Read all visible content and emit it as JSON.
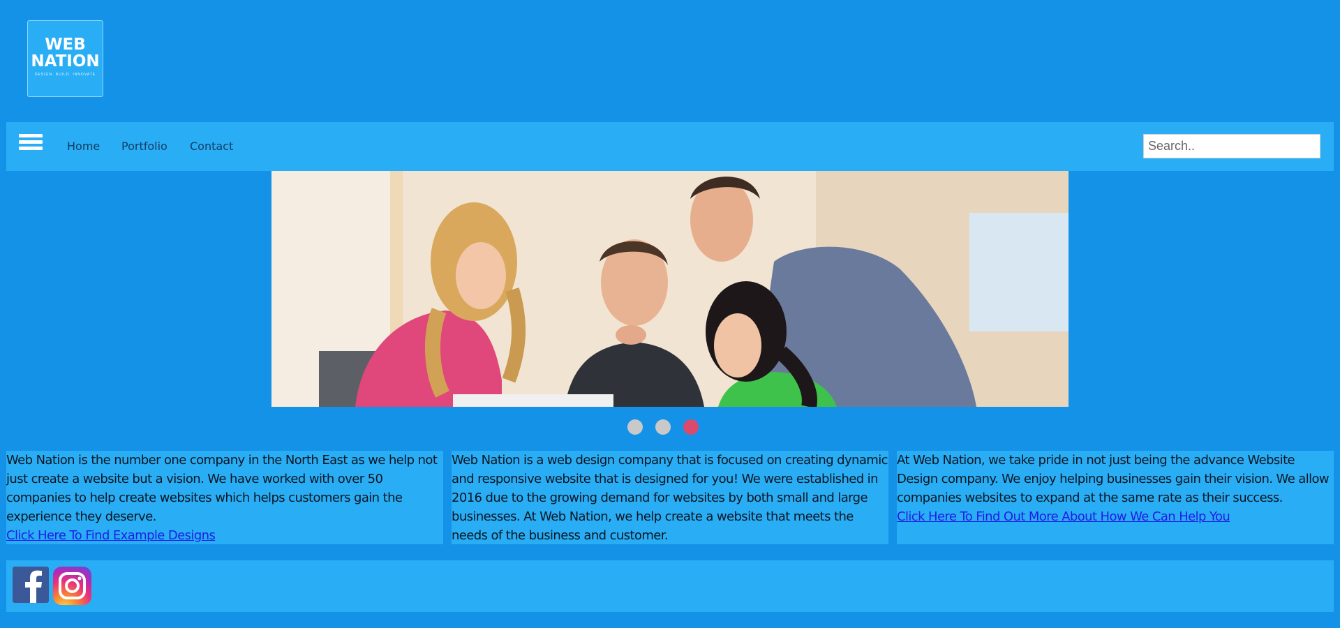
{
  "logo": {
    "line1": "WEB",
    "line2": "NATION",
    "tagline": "DESIGN. BUILD. INNOVATE"
  },
  "nav": {
    "menu_icon": "hamburger-menu-icon",
    "links": [
      "Home",
      "Portfolio",
      "Contact"
    ],
    "search_placeholder": "Search.."
  },
  "slideshow": {
    "dot_count": 3,
    "active_dot": 3,
    "colors": {
      "dot": "#c9c9c9",
      "dot_active": "#db4a6c"
    }
  },
  "columns": [
    {
      "text": "Web Nation is the number one company in the North East as we help not just create a website but a vision. We have worked with over 50 companies to help create websites which helps customers gain the experience they deserve.",
      "link": "Click Here To Find Example Designs"
    },
    {
      "text": "Web Nation is a web design company that is focused on creating dynamic and responsive website that is designed for you! We were established in 2016 due to the growing demand for websites by both small and large businesses. At Web Nation, we help create a website that meets the needs of the business and customer."
    },
    {
      "text": "At Web Nation, we take pride in not just being the advance Website Design company. We enjoy helping businesses gain their vision. We allow companies websites to expand at the same rate as their success.",
      "link": "Click Here To Find Out More About How We Can Help You"
    }
  ],
  "footer": {
    "icons": [
      "facebook-icon",
      "instagram-icon"
    ]
  },
  "colors": {
    "page_bg": "#1492e8",
    "panel_bg": "#29aef6",
    "link": "#1f1ee5",
    "facebook": "#3b5998"
  }
}
